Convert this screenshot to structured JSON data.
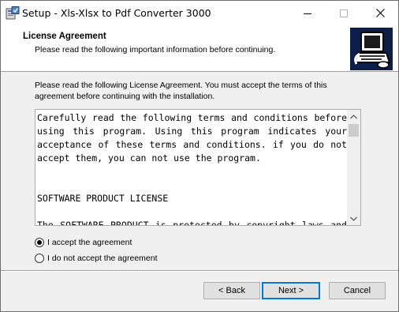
{
  "window": {
    "title": "Setup - Xls-Xlsx to Pdf Converter 3000",
    "app_icon": "setup-installer-icon",
    "controls": [
      "minimize-icon",
      "maximize-icon",
      "close-icon"
    ]
  },
  "header": {
    "title": "License Agreement",
    "subtitle": "Please read the following important information before continuing.",
    "logo_icon": "computer-install-icon"
  },
  "intro": "Please read the following License Agreement. You must accept the terms of this agreement before continuing with the installation.",
  "license": {
    "paragraph1": "Carefully read the following terms and conditions before using this program. Using this program indicates your acceptance of these terms and conditions. if you do not accept them, you can not use the program.",
    "heading": "SOFTWARE PRODUCT LICENSE",
    "paragraph2": "The SOFTWARE PRODUCT is protected by copyright laws and"
  },
  "options": {
    "accept": {
      "label": "I accept the agreement",
      "selected": true
    },
    "decline": {
      "label": "I do not accept the agreement",
      "selected": false
    }
  },
  "buttons": {
    "back": "< Back",
    "next": "Next >",
    "cancel": "Cancel"
  },
  "colors": {
    "focus_border": "#0078d7",
    "window_bg": "#f0f0f0",
    "header_logo_bg": "#0b1f4a"
  }
}
